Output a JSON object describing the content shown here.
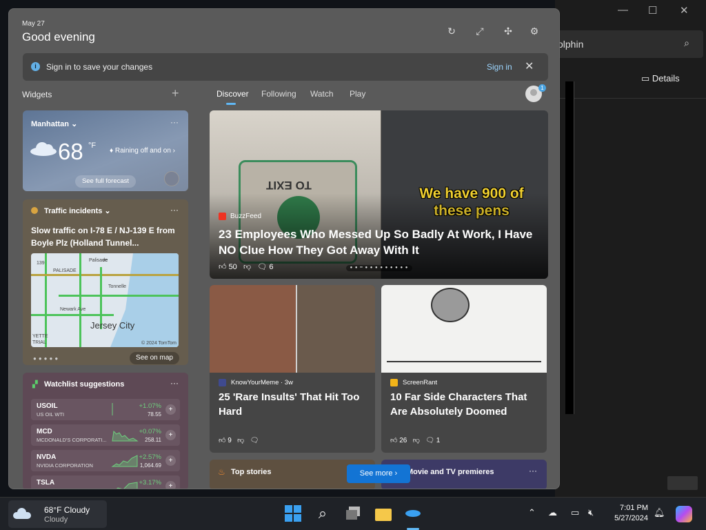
{
  "bg_window": {
    "search_text": "olphin",
    "details_label": "Details"
  },
  "header": {
    "date": "May 27",
    "greeting": "Good evening"
  },
  "banner": {
    "text": "Sign in to save your changes",
    "signin": "Sign in"
  },
  "widgets_label": "Widgets",
  "tabs": [
    "Discover",
    "Following",
    "Watch",
    "Play"
  ],
  "avatar_badge": "1",
  "weather": {
    "city": "Manhattan",
    "temp": "68",
    "unit": "°F",
    "condition": "Raining off and on",
    "forecast_button": "See full forecast"
  },
  "traffic": {
    "header": "Traffic incidents",
    "title": "Slow traffic on I-78 E / NJ-139 E from Boyle Plz (Holland Tunnel...",
    "map_city": "Jersey City",
    "map_labels": [
      "139",
      "PALISADE",
      "Palisade",
      "ve",
      "Tonnelle",
      "YETTE",
      "TRIAL",
      "Newark Ave"
    ],
    "map_copyright": "© 2024 TomTom",
    "see_on_map": "See on map"
  },
  "watchlist": {
    "header": "Watchlist suggestions",
    "stocks": [
      {
        "symbol": "USOIL",
        "name": "US OIL WTI",
        "change": "+1.07%",
        "price": "78.55"
      },
      {
        "symbol": "MCD",
        "name": "MCDONALD'S CORPORATI...",
        "change": "+0.07%",
        "price": "258.11"
      },
      {
        "symbol": "NVDA",
        "name": "NVIDIA CORPORATION",
        "change": "+2.57%",
        "price": "1,064.69"
      },
      {
        "symbol": "TSLA",
        "name": "",
        "change": "+3.17%",
        "price": ""
      }
    ]
  },
  "hero": {
    "source": "BuzzFeed",
    "title": "23 Employees Who Messed Up So Badly At Work, I Have NO Clue How They Got Away With It",
    "likes": "50",
    "comments": "6",
    "image_text_left": "TO EXIT",
    "image_text_right": "We have 900 of these pens"
  },
  "news": [
    {
      "source": "KnowYourMeme · 3w",
      "title": "25 'Rare Insults' That Hit Too Hard",
      "likes": "9",
      "comments": ""
    },
    {
      "source": "ScreenRant",
      "title": "10 Far Side Characters That Are Absolutely Doomed",
      "likes": "26",
      "comments": "1"
    }
  ],
  "bottom": {
    "top_stories": "Top stories",
    "see_more": "See more",
    "premieres": "Movie and TV premieres"
  },
  "taskbar": {
    "weather_temp": "68°F Cloudy",
    "weather_sub": "Cloudy",
    "time": "7:01 PM",
    "date": "5/27/2024"
  },
  "colors": {
    "accent": "#1374d4",
    "positive": "#6ed07e",
    "panel": "#5a5a5a"
  }
}
